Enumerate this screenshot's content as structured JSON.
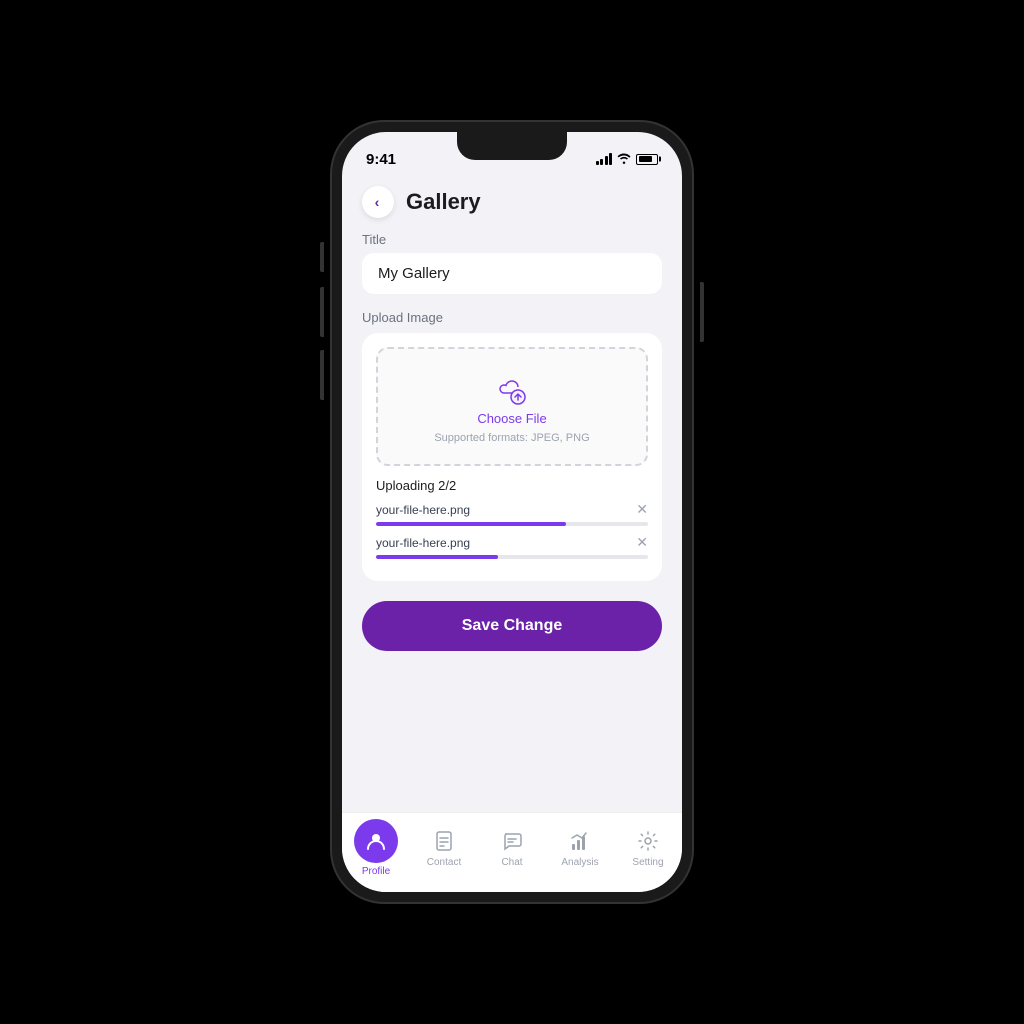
{
  "statusBar": {
    "time": "9:41"
  },
  "header": {
    "backLabel": "‹",
    "title": "Gallery"
  },
  "form": {
    "titleFieldLabel": "Title",
    "titleFieldValue": "My Gallery",
    "uploadSectionLabel": "Upload Image",
    "chooseFileLink": "Choose File",
    "supportedFormats": "Supported formats: JPEG, PNG",
    "uploadingLabel": "Uploading 2/2",
    "file1Name": "your-file-here.png",
    "file2Name": "your-file-here.png",
    "file1Progress": 70,
    "file2Progress": 45
  },
  "saveButton": {
    "label": "Save Change"
  },
  "bottomNav": {
    "items": [
      {
        "label": "Contact",
        "icon": "contact"
      },
      {
        "label": "Chat",
        "icon": "chat"
      },
      {
        "label": "Analysis",
        "icon": "analysis"
      },
      {
        "label": "Setting",
        "icon": "setting"
      }
    ],
    "activeIndex": -1
  }
}
